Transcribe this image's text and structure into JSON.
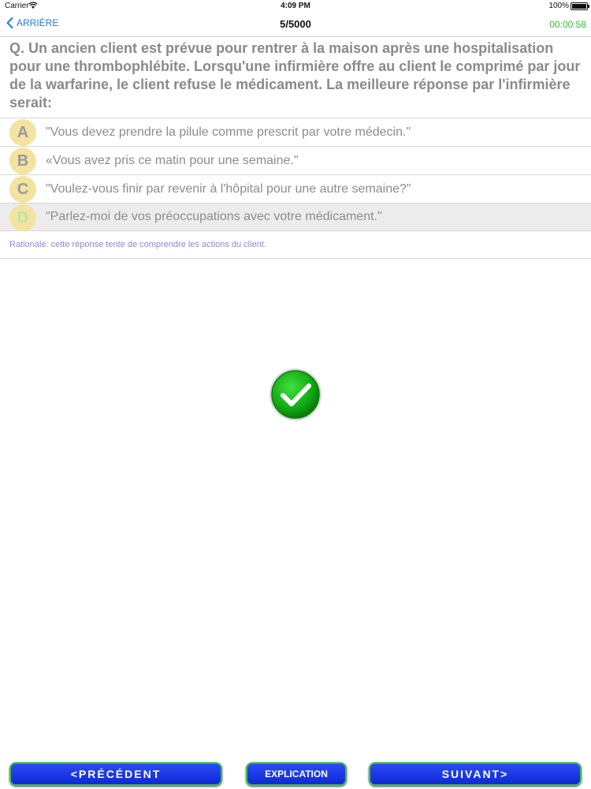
{
  "status_bar": {
    "carrier": "Carrier",
    "time": "4:09 PM",
    "battery": "100%"
  },
  "nav": {
    "back_label": "ARRIÈRE",
    "title": "5/5000",
    "timer": "00:00:58"
  },
  "question": {
    "text": "Q. Un ancien client est prévue pour rentrer à la maison après une hospitalisation pour une thrombophlébite. Lorsqu'une infirmière offre au client le comprimé par jour de la warfarine, le client refuse le médicament. La meilleure réponse par l'infirmière serait:"
  },
  "answers": [
    {
      "letter": "A",
      "text": "\"Vous devez prendre la pilule comme prescrit par votre médecin.\""
    },
    {
      "letter": "B",
      "text": "«Vous avez pris ce matin pour une semaine.\""
    },
    {
      "letter": "C",
      "text": "\"Voulez-vous finir par revenir à l'hôpital pour une autre semaine?\""
    },
    {
      "letter": "D",
      "text": "\"Parlez-moi de vos préoccupations avec votre médicament.\""
    }
  ],
  "selected_answer": "D",
  "rationale": {
    "text": "Rationale: cette réponse tente de comprendre les actions du client."
  },
  "result_icon": "green-checkmark-icon",
  "buttons": {
    "prev": "<PRÉCÉDENT",
    "explanation": "EXPLICATION",
    "next": "SUIVANT>"
  },
  "colors": {
    "accent_blue": "#1f7adf",
    "timer_green": "#2fc12f",
    "button_blue": "#1a3ae6",
    "button_border": "#3bc143",
    "rationale": "#8a8ad6"
  }
}
